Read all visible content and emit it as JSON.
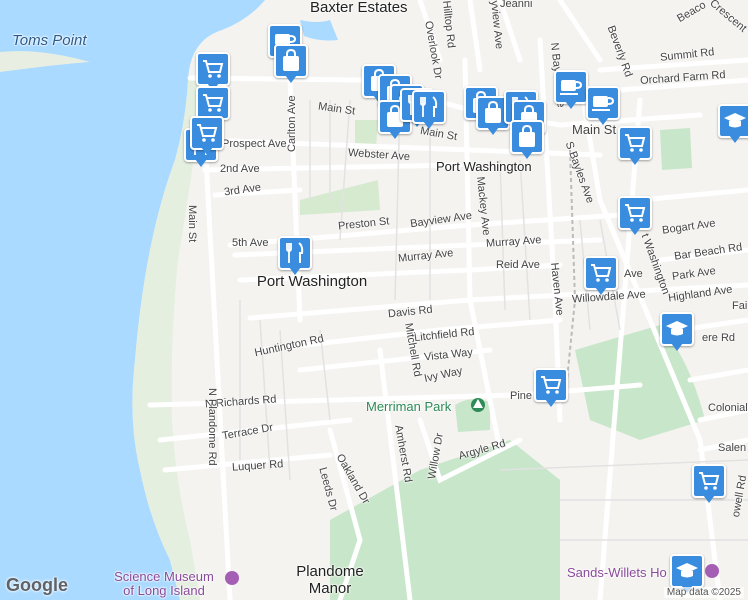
{
  "labels": {
    "baxter_estates": "Baxter Estates",
    "toms_point": "Toms Point",
    "port_washington_north": "Port Washington",
    "port_washington": "Port Washington",
    "plandome_manor": "Plandome Manor",
    "merriman_park": "Merriman Park",
    "science_museum": "Science Museum of Long Island",
    "sands_willets": "Sands-Willets Ho",
    "main_st_w": "Main St",
    "main_st_mid": "Main St",
    "main_st_e": "Main St",
    "main_st_vertical": "Main St",
    "prospect_ave": "Prospect Ave",
    "second_ave": "2nd Ave",
    "third_ave": "3rd Ave",
    "fifth_ave": "5th Ave",
    "webster_ave": "Webster Ave",
    "carlton_ave": "Carlton Ave",
    "preston_st": "Preston St",
    "bayview_ave": "Bayview Ave",
    "murray_ave_w": "Murray Ave",
    "murray_ave_e": "Murray Ave",
    "reid_ave": "Reid Ave",
    "davis_rd": "Davis Rd",
    "litchfield_rd": "Litchfield Rd",
    "vista_way": "Vista Way",
    "ivy_way": "Ivy Way",
    "mitchell_rd": "Mitchell Rd",
    "huntington_rd": "Huntington Rd",
    "n_richards_rd": "N Richards Rd",
    "terrace_dr": "Terrace Dr",
    "luquer_rd": "Luquer Rd",
    "n_plandome_rd": "N Plandome Rd",
    "oakland_dr": "Oakland Dr",
    "leeds_dr": "Leeds Dr",
    "amherst_rd": "Amherst Rd",
    "willow_dr": "Willow Dr",
    "argyle_rd": "Argyle Rd",
    "pine": "Pine",
    "mackey_ave": "Mackey Ave",
    "haven_ave": "Haven Ave",
    "s_bayles_ave": "S Bayles Ave",
    "n_bayles_ave": "N Bayles Ave",
    "bogart_ave": "Bogart Ave",
    "bar_beach_rd": "Bar Beach Rd",
    "park_ave": "Park Ave",
    "highland_ave": "Highland Ave",
    "willowdale_ave": "Willowdale Ave",
    "ave_short": "Ave",
    "overlook_dr": "Overlook Dr",
    "hilltop_rd": "Hilltop Rd",
    "bayview_ave_n": "yview Ave",
    "beverly_rd": "Beverly Rd",
    "summit_rd": "Summit Rd",
    "orchard_farm_rd": "Orchard Farm Rd",
    "crescent": "Crescent",
    "beacon": "Beaco",
    "colonial": "Colonial",
    "salem": "Salen",
    "lowell_rd": "owell Rd",
    "port_washington_blvd": "t Washington",
    "fai": "Fai",
    "ere_rd": "ere Rd",
    "jean": "Jeanni"
  },
  "attribution": "Map data ©2025",
  "logo": "Google",
  "colors": {
    "water": "#aadaff",
    "park": "#c8e6c9",
    "road": "#ffffff",
    "pin": "#3a8dde"
  },
  "markers": [
    {
      "icon": "grocery-cart-icon"
    },
    {
      "icon": "grocery-cart-icon"
    },
    {
      "icon": "restaurant-icon"
    },
    {
      "icon": "grocery-cart-icon"
    },
    {
      "icon": "coffee-icon"
    },
    {
      "icon": "shopping-bag-icon"
    },
    {
      "icon": "restaurant-icon"
    },
    {
      "icon": "shopping-bag-icon"
    },
    {
      "icon": "shopping-bag-icon"
    },
    {
      "icon": "coffee-icon"
    },
    {
      "icon": "coffee-icon"
    },
    {
      "icon": "shopping-bag-icon"
    },
    {
      "icon": "grocery-cart-icon"
    },
    {
      "icon": "shopping-bag-icon"
    },
    {
      "icon": "grocery-cart-icon"
    },
    {
      "icon": "grocery-cart-icon"
    },
    {
      "icon": "school-icon"
    },
    {
      "icon": "grocery-cart-icon"
    },
    {
      "icon": "school-icon"
    },
    {
      "icon": "grocery-cart-icon"
    },
    {
      "icon": "school-icon"
    },
    {
      "icon": "shopping-bag-icon"
    },
    {
      "icon": "coffee-icon"
    }
  ]
}
